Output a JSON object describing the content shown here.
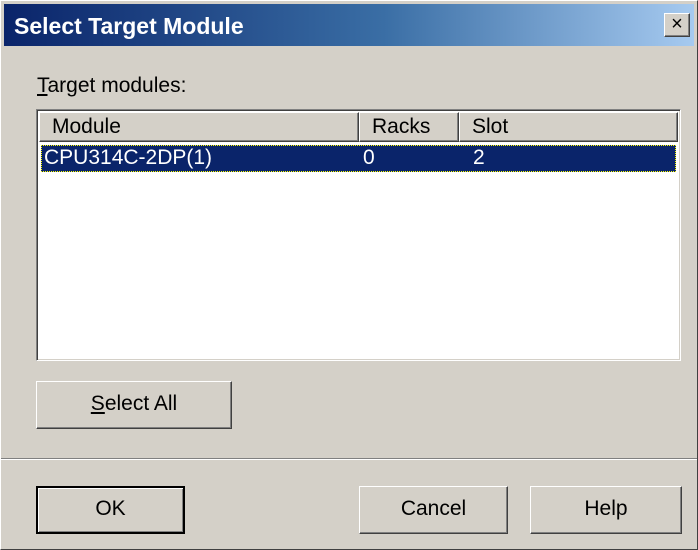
{
  "window": {
    "title": "Select Target Module",
    "close_glyph": "×"
  },
  "target_modules_label": {
    "mnemonic": "T",
    "rest": "arget modules:"
  },
  "table": {
    "columns": [
      "Module",
      "Racks",
      "Slot"
    ],
    "rows": [
      {
        "module": "CPU314C-2DP(1)",
        "racks": "0",
        "slot": "2",
        "selected": true
      }
    ]
  },
  "buttons": {
    "select_all": {
      "mnemonic": "S",
      "rest": "elect All"
    },
    "ok": "OK",
    "cancel": "Cancel",
    "help": "Help"
  },
  "colors": {
    "selection_bg": "#0a246a",
    "titlebar_start": "#0a246a",
    "titlebar_end": "#a6caf0",
    "dialog_bg": "#d4d0c8"
  }
}
